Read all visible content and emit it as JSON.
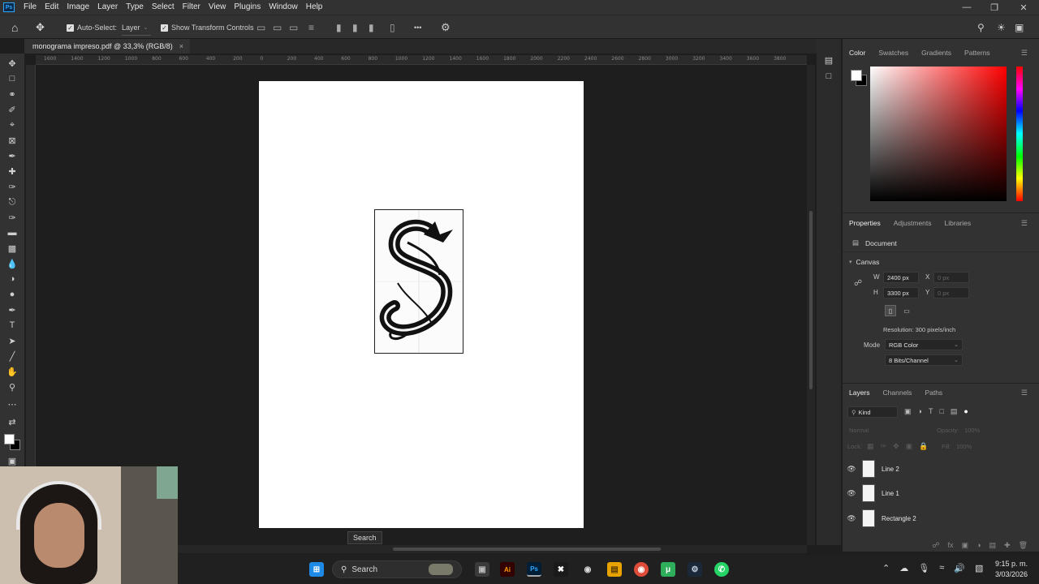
{
  "app": {
    "logo": "Ps"
  },
  "menu": [
    "File",
    "Edit",
    "Image",
    "Layer",
    "Type",
    "Select",
    "Filter",
    "View",
    "Plugins",
    "Window",
    "Help"
  ],
  "options": {
    "auto_select_label": "Auto-Select:",
    "auto_select_target": "Layer",
    "show_transform_label": "Show Transform Controls",
    "more_glyph": "•••"
  },
  "document_tab": {
    "title": "monograma impreso.pdf @ 33,3% (RGB/8)",
    "close": "×"
  },
  "ruler_ticks": [
    "1600",
    "1400",
    "1200",
    "1000",
    "800",
    "600",
    "400",
    "200",
    "0",
    "200",
    "400",
    "600",
    "800",
    "1000",
    "1200",
    "1400",
    "1600",
    "1800",
    "2000",
    "2200",
    "2400",
    "2600",
    "2800",
    "3000",
    "3200",
    "3400",
    "3600",
    "3800"
  ],
  "color_panel": {
    "tabs": [
      "Color",
      "Swatches",
      "Gradients",
      "Patterns"
    ],
    "active": "Color"
  },
  "properties_panel": {
    "tabs": [
      "Properties",
      "Adjustments",
      "Libraries"
    ],
    "active": "Properties",
    "section_kind": "Document",
    "canvas_heading": "Canvas",
    "w_label": "W",
    "h_label": "H",
    "x_label": "X",
    "y_label": "Y",
    "width_value": "2400 px",
    "height_value": "3300 px",
    "x_value": "0 px",
    "y_value": "0 px",
    "resolution": "Resolution: 300 pixels/inch",
    "mode_label": "Mode",
    "mode_value": "RGB Color",
    "bits_value": "8 Bits/Channel"
  },
  "layers_panel": {
    "tabs": [
      "Layers",
      "Channels",
      "Paths"
    ],
    "active": "Layers",
    "filter_kind": "Kind",
    "blend_mode": "Normal",
    "opacity_label": "Opacity:",
    "opacity_value": "100%",
    "lock_label": "Lock:",
    "fill_label": "Fill:",
    "fill_value": "100%",
    "layers": [
      {
        "name": "Line 2"
      },
      {
        "name": "Line 1"
      },
      {
        "name": "Rectangle 2"
      }
    ]
  },
  "taskbar": {
    "search_placeholder": "Search",
    "tooltip": "Search",
    "time": "9:15 p. m.",
    "date": "3/03/2026"
  }
}
